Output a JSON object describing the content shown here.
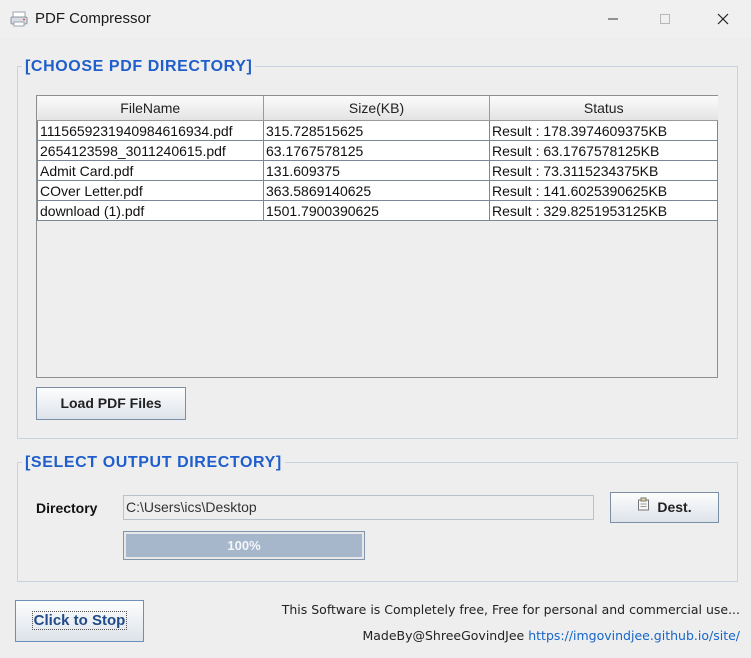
{
  "window": {
    "title": "PDF Compressor"
  },
  "choose_section": {
    "title": "[CHOOSE PDF DIRECTORY]",
    "table": {
      "columns": [
        "FileName",
        "Size(KB)",
        "Status"
      ],
      "rows": [
        [
          "1115659231940984616934.pdf",
          "315.728515625",
          "Result : 178.3974609375KB"
        ],
        [
          "2654123598_3011240615.pdf",
          "63.1767578125",
          "Result : 63.1767578125KB"
        ],
        [
          "Admit Card.pdf",
          "131.609375",
          "Result : 73.3115234375KB"
        ],
        [
          "COver Letter.pdf",
          "363.5869140625",
          "Result : 141.6025390625KB"
        ],
        [
          "download (1).pdf",
          "1501.7900390625",
          "Result : 329.8251953125KB"
        ]
      ]
    },
    "load_button": "Load PDF Files"
  },
  "output_section": {
    "title": "[SELECT OUTPUT DIRECTORY]",
    "directory_label": "Directory",
    "directory_value": "C:\\Users\\ics\\Desktop",
    "dest_button": "Dest.",
    "progress": {
      "text": "100%",
      "value": 1.0
    }
  },
  "footer": {
    "stop_button": "Click to Stop",
    "free_text": "This Software is Completely free, Free for personal and commercial use...",
    "made_by": "MadeBy@ShreeGovindJee",
    "site_link": "https://imgovindjee.github.io/site/"
  },
  "colors": {
    "accent": "#1f5ecb",
    "link": "#1565c8",
    "progress_fill": "#a6b7cb"
  },
  "icons": [
    "pdf-app-icon",
    "minimize-icon",
    "maximize-icon",
    "close-icon",
    "folder-icon"
  ]
}
